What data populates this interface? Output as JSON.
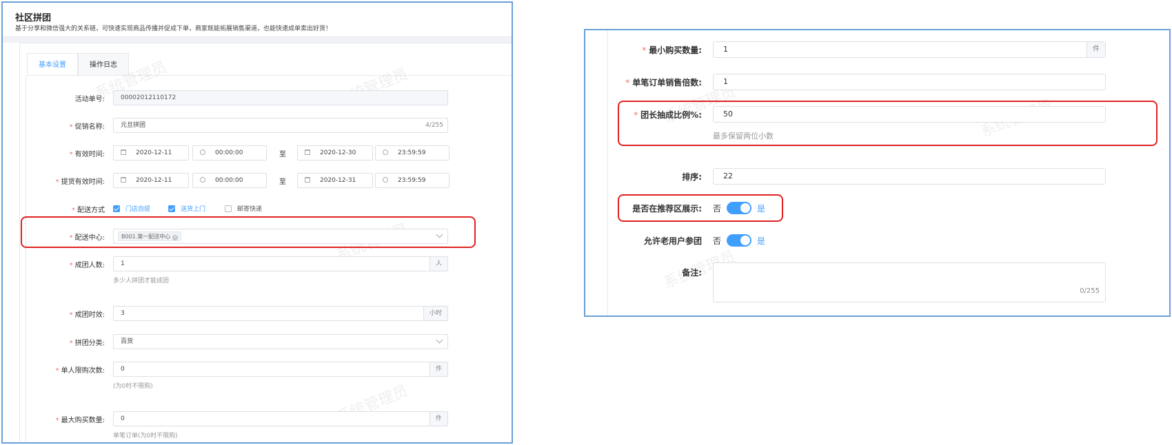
{
  "header": {
    "title": "社区拼团",
    "description": "基于分享和微信强大的关系链，可快速实现商品传播并促成下单，商家既能拓展销售渠道，也能快速成单卖出好货！"
  },
  "tabs": [
    {
      "label": "基本设置",
      "active": true
    },
    {
      "label": "操作日志",
      "active": false
    }
  ],
  "watermark": "系统管理员",
  "form": {
    "activity_no": {
      "label": "活动单号:",
      "value": "00002012110172"
    },
    "promo_name": {
      "label": "促销名称:",
      "value": "元旦拼团",
      "count": "4/255"
    },
    "valid_time": {
      "label": "有效时间:",
      "start_date": "2020-12-11",
      "start_time": "00:00:00",
      "sep": "至",
      "end_date": "2020-12-30",
      "end_time": "23:59:59"
    },
    "pickup_time": {
      "label": "提货有效时间:",
      "start_date": "2020-12-11",
      "start_time": "00:00:00",
      "sep": "至",
      "end_date": "2020-12-31",
      "end_time": "23:59:59"
    },
    "delivery_method": {
      "label": "配送方式",
      "options": [
        {
          "label": "门店自提",
          "checked": true
        },
        {
          "label": "送货上门",
          "checked": true
        },
        {
          "label": "邮寄快递",
          "checked": false
        }
      ]
    },
    "delivery_center": {
      "label": "配送中心:",
      "tag": "B001.第一配送中心"
    },
    "group_size": {
      "label": "成团人数:",
      "value": "1",
      "unit": "人",
      "hint": "多少人拼团才能成团"
    },
    "group_duration": {
      "label": "成团时效:",
      "value": "3",
      "unit": "小时"
    },
    "group_category": {
      "label": "拼团分类:",
      "value": "百货"
    },
    "per_user_limit": {
      "label": "单人限购次数:",
      "value": "0",
      "unit": "件",
      "hint": "(为0时不限购)"
    },
    "max_purchase": {
      "label": "最大购买数量:",
      "value": "0",
      "unit": "件",
      "hint": "单笔订单(为0时不限购)"
    }
  },
  "right_form": {
    "min_purchase": {
      "label": "最小购买数量:",
      "value": "1",
      "unit": "件"
    },
    "order_multiple": {
      "label": "单笔订单销售倍数:",
      "value": "1"
    },
    "leader_ratio": {
      "label": "团长抽成比例%:",
      "value": "50",
      "hint": "最多保留两位小数"
    },
    "sort": {
      "label": "排序:",
      "value": "22"
    },
    "show_recommend": {
      "label": "是否在推荐区展示:",
      "off_text": "否",
      "on_text": "是",
      "on": true
    },
    "allow_old_user": {
      "label": "允许老用户参团",
      "off_text": "否",
      "on_text": "是",
      "on": true
    },
    "remark": {
      "label": "备注:",
      "count": "0/255"
    }
  },
  "colors": {
    "accent": "#409eff",
    "required": "#f56c6c",
    "highlight": "#e02020",
    "frame": "#6a9fd8"
  }
}
